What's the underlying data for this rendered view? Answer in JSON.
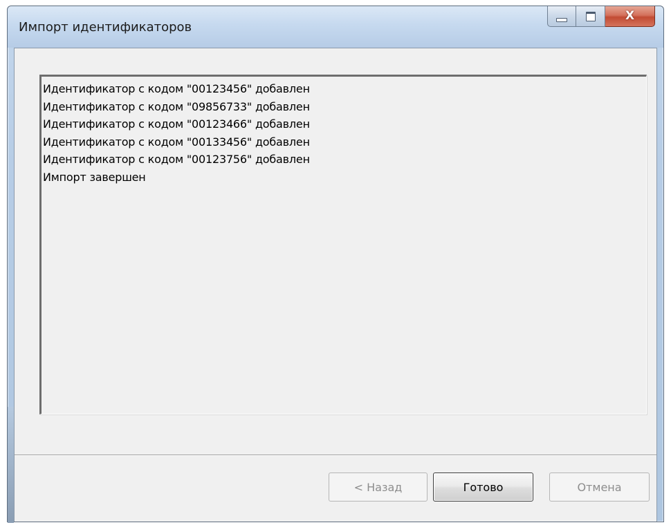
{
  "window": {
    "title": "Импорт идентификаторов",
    "caption": {
      "minimize_icon": "minimize-icon",
      "maximize_icon": "maximize-icon",
      "close_icon": "close-icon",
      "close_glyph": "X"
    }
  },
  "log": {
    "lines": [
      "Идентификатор с кодом \"00123456\" добавлен",
      "Идентификатор с кодом \"09856733\" добавлен",
      "Идентификатор с кодом \"00123466\" добавлен",
      "Идентификатор с кодом \"00133456\" добавлен",
      "Идентификатор с кодом \"00123756\" добавлен",
      "Импорт завершен"
    ]
  },
  "buttons": {
    "back": {
      "label": "< Назад",
      "enabled": false
    },
    "done": {
      "label": "Готово",
      "enabled": true
    },
    "cancel": {
      "label": "Отмена",
      "enabled": false
    }
  },
  "colors": {
    "titlebar": "#c6d9ef",
    "client_bg": "#f0f0f0",
    "close_button": "#c24b33",
    "disabled_text": "#8d8d8d"
  }
}
